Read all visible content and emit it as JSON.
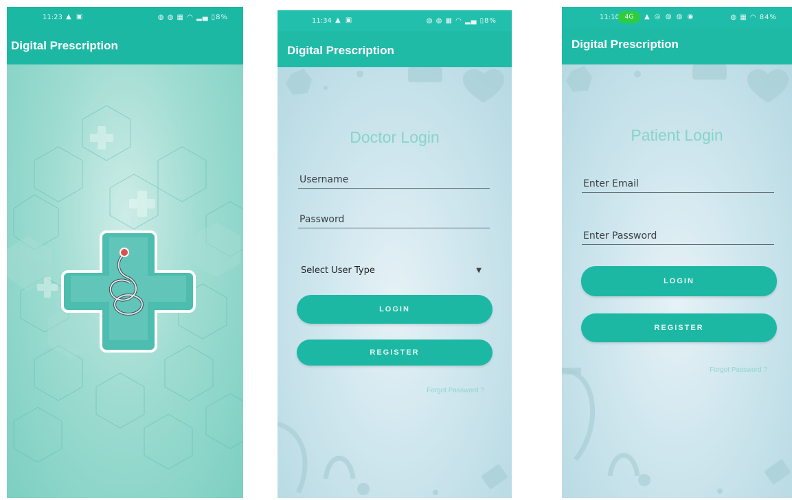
{
  "screens": [
    {
      "status": {
        "time": "11:23",
        "left_icons": "▲ ▣",
        "right_icons": "◍ ◍ ▦ ◠ ▂▄ ▯8%"
      },
      "app_title": "Digital Prescription"
    },
    {
      "status": {
        "time": "11:34",
        "left_icons": "▲ ▣",
        "right_icons": "◍ ◍ ▦ ◠ ▂▄ ▯8%"
      },
      "app_title": "Digital Prescription",
      "title": "Doctor Login",
      "username_placeholder": "Username",
      "password_placeholder": "Password",
      "user_type_label": "Select User Type",
      "login_label": "LOGIN",
      "register_label": "REGISTER",
      "forgot_label": "Forgot Password ?"
    },
    {
      "status": {
        "time": "11:10",
        "pill": "4G",
        "left_icons": "▲ ◎ ◍ ◍ ◉",
        "right_icons": "◍ ▦ ◠ 84%"
      },
      "app_title": "Digital Prescription",
      "title": "Patient Login",
      "email_placeholder": "Enter Email",
      "password_placeholder": "Enter Password",
      "login_label": "LOGIN",
      "register_label": "REGISTER",
      "forgot_label": "Forgot Password ?"
    }
  ],
  "colors": {
    "primary": "#1db8a4",
    "title_tint": "#86d4cb"
  }
}
